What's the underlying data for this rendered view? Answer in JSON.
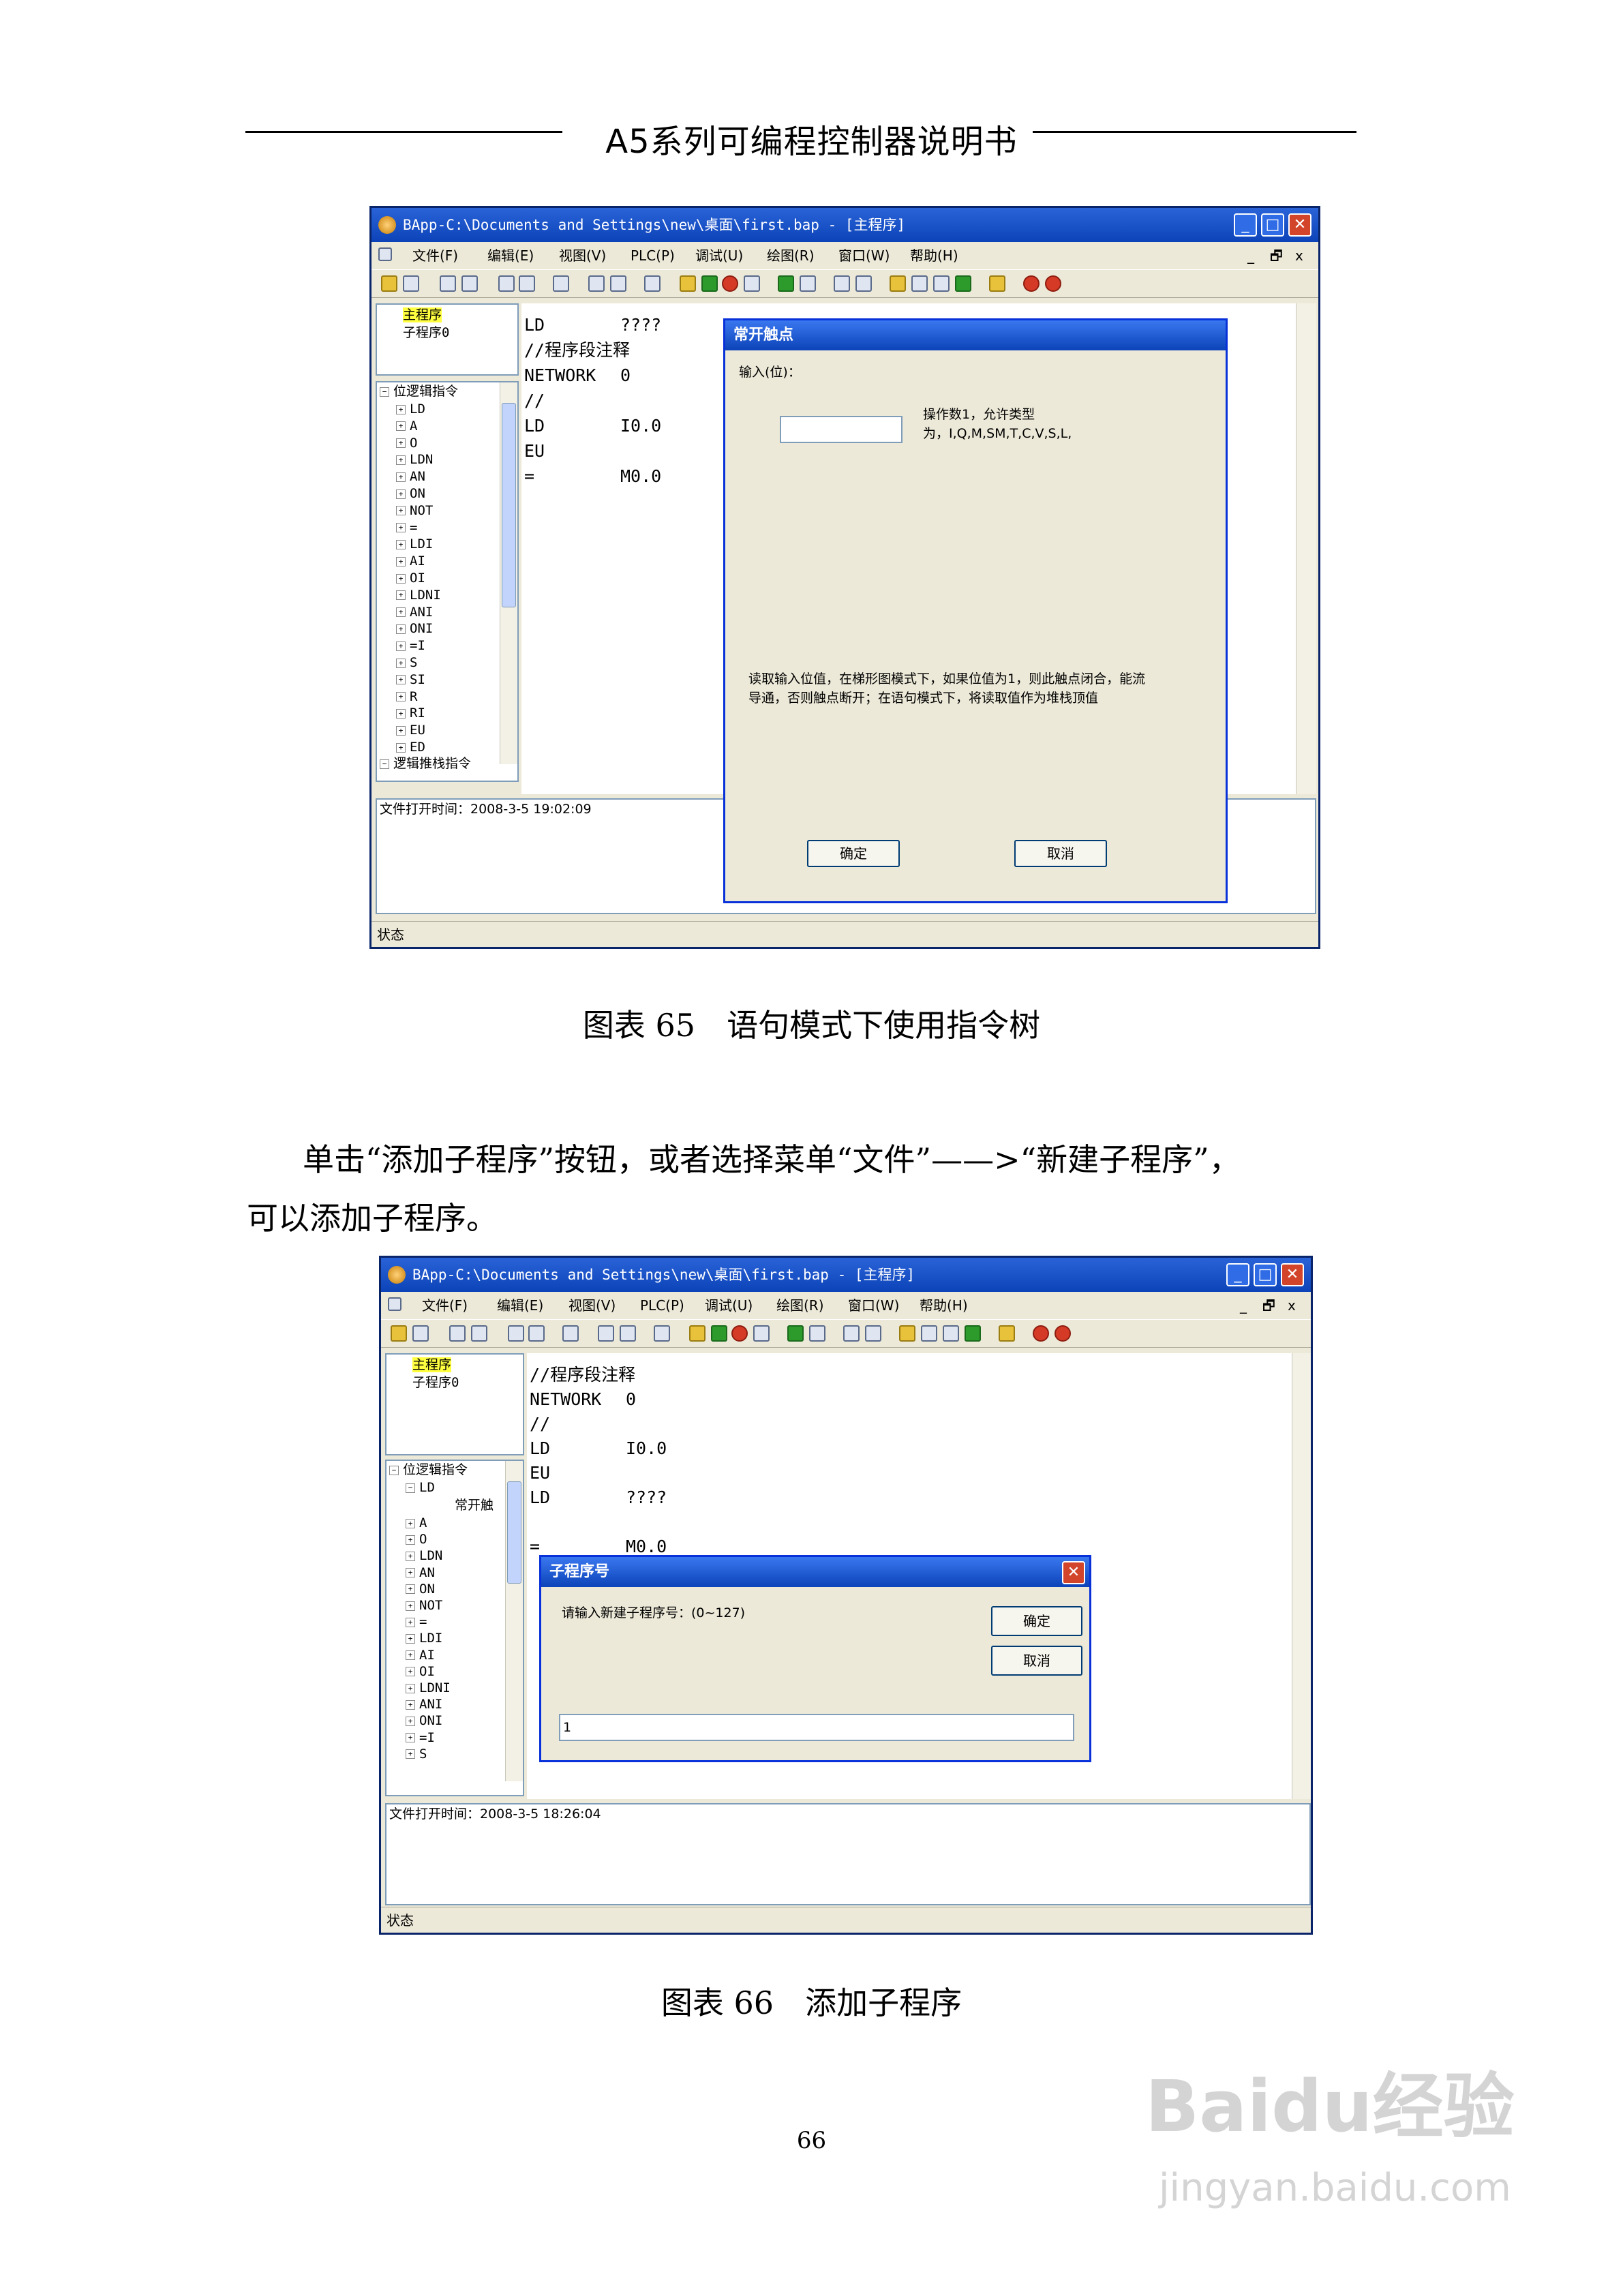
{
  "header": {
    "title": "A5系列可编程控制器说明书"
  },
  "figure65": {
    "window_title": "BApp-C:\\Documents and Settings\\new\\桌面\\first.bap - [主程序]",
    "menu": [
      "文件(F)",
      "编辑(E)",
      "视图(V)",
      "PLC(P)",
      "调试(U)",
      "绘图(R)",
      "窗口(W)",
      "帮助(H)"
    ],
    "doc_controls": {
      "minimize": "_",
      "restore": "🗗",
      "close": "x"
    },
    "program_tree": [
      "主程序",
      "子程序0"
    ],
    "instr_tree": {
      "root": "位逻辑指令",
      "items": [
        "LD",
        "A",
        "O",
        "LDN",
        "AN",
        "ON",
        "NOT",
        "=",
        "LDI",
        "AI",
        "OI",
        "LDNI",
        "ANI",
        "ONI",
        "=I",
        "S",
        "SI",
        "R",
        "RI",
        "EU",
        "ED"
      ],
      "next_root": "逻辑推栈指令"
    },
    "code": [
      {
        "op": "LD",
        "arg": "????"
      },
      {
        "op": "//程序段注释",
        "arg": ""
      },
      {
        "op": "NETWORK",
        "arg": "0"
      },
      {
        "op": "//",
        "arg": ""
      },
      {
        "op": "LD",
        "arg": "I0.0"
      },
      {
        "op": "EU",
        "arg": ""
      },
      {
        "op": "=",
        "arg": "M0.0"
      }
    ],
    "output_line": "文件打开时间：2008-3-5 19:02:09",
    "status": "状态",
    "dialog": {
      "title": "常开触点",
      "input_label": "输入(位)：",
      "hint_line1": "操作数1，允许类型",
      "hint_line2": "为，I,Q,M,SM,T,C,V,S,L,",
      "desc_line1": "读取输入位值，在梯形图模式下，如果位值为1，则此触点闭合，能流",
      "desc_line2": "导通，否则触点断开；在语句模式下，将读取值作为堆栈顶值",
      "ok": "确定",
      "cancel": "取消"
    }
  },
  "caption65": "图表 65　语句模式下使用指令树",
  "paragraph_line1": "单击“添加子程序”按钮，或者选择菜单“文件”——>“新建子程序”，",
  "paragraph_line2": "可以添加子程序。",
  "figure66": {
    "window_title": "BApp-C:\\Documents and Settings\\new\\桌面\\first.bap - [主程序]",
    "menu": [
      "文件(F)",
      "编辑(E)",
      "视图(V)",
      "PLC(P)",
      "调试(U)",
      "绘图(R)",
      "窗口(W)",
      "帮助(H)"
    ],
    "doc_controls": {
      "minimize": "_",
      "restore": "🗗",
      "close": "x"
    },
    "program_tree": [
      "主程序",
      "子程序0"
    ],
    "instr_tree": {
      "root": "位逻辑指令",
      "ld": "LD",
      "ld_child": "常开触",
      "items": [
        "A",
        "O",
        "LDN",
        "AN",
        "ON",
        "NOT",
        "=",
        "LDI",
        "AI",
        "OI",
        "LDNI",
        "ANI",
        "ONI",
        "=I",
        "S"
      ]
    },
    "code": [
      {
        "op": "//程序段注释",
        "arg": ""
      },
      {
        "op": "NETWORK",
        "arg": "0"
      },
      {
        "op": "//",
        "arg": ""
      },
      {
        "op": "LD",
        "arg": "I0.0"
      },
      {
        "op": "EU",
        "arg": ""
      },
      {
        "op": "LD",
        "arg": "????"
      },
      {
        "op": "",
        "arg": ""
      },
      {
        "op": "=",
        "arg": "M0.0"
      }
    ],
    "output_line": "文件打开时间：2008-3-5 18:26:04",
    "status": "状态",
    "dialog": {
      "title": "子程序号",
      "prompt": "请输入新建子程序号：(0~127)",
      "ok": "确定",
      "cancel": "取消",
      "value": "1",
      "close": "✕"
    }
  },
  "caption66": "图表 66　添加子程序",
  "page_number": "66",
  "watermark": {
    "brand": "Baidu经验",
    "url": "jingyan.baidu.com"
  }
}
